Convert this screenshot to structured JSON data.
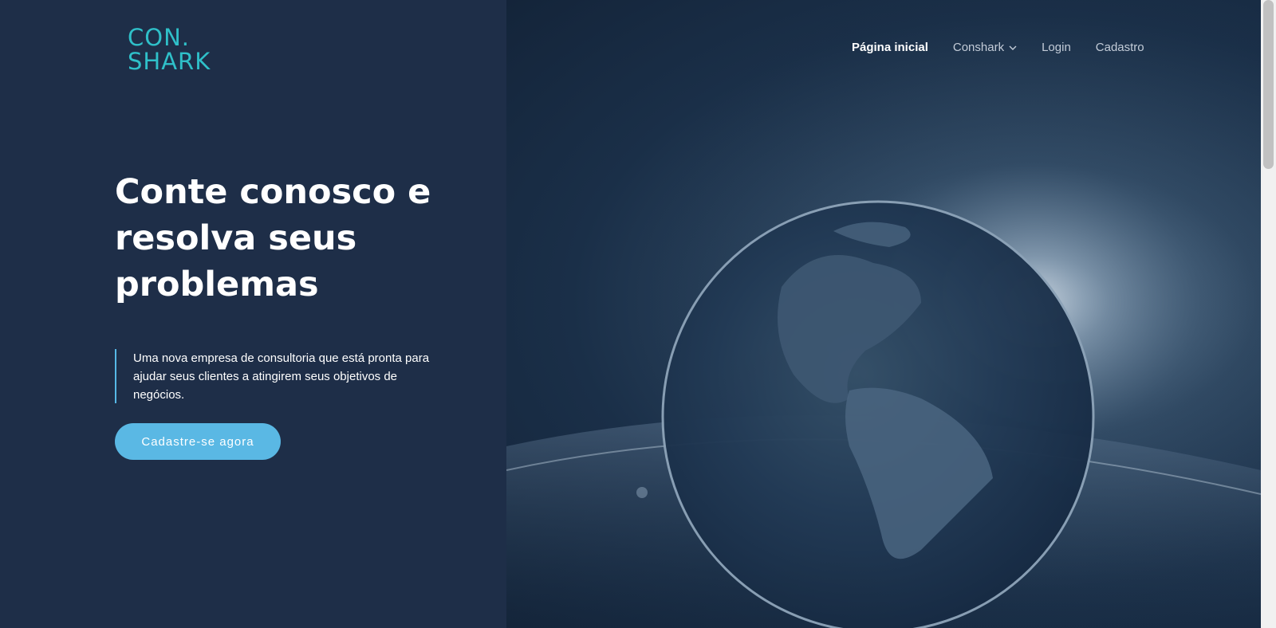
{
  "brand": {
    "logo_line1": "CON.",
    "logo_line2": "SHARK"
  },
  "nav": {
    "items": [
      {
        "label": "Página inicial",
        "active": true
      },
      {
        "label": "Conshark",
        "has_dropdown": true
      },
      {
        "label": "Login"
      },
      {
        "label": "Cadastro"
      }
    ]
  },
  "hero": {
    "title": "Conte conosco e resolva seus problemas",
    "description": "Uma nova empresa de consultoria que está pronta para ajudar seus clientes a atingirem seus objetivos de negócios.",
    "cta_label": "Cadastre-se agora"
  },
  "colors": {
    "background": "#1e2e48",
    "accent": "#5ab8e4",
    "logo": "#2fc0c9"
  },
  "icons": [
    "chevron-down-icon"
  ]
}
